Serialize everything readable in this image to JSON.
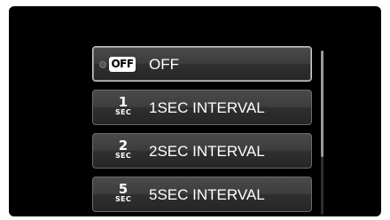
{
  "menu": {
    "items": [
      {
        "icon": "off-icon",
        "icon_text": "OFF",
        "label": "OFF",
        "selected": true
      },
      {
        "icon": "1sec-icon",
        "icon_num": "1",
        "icon_unit": "SEC",
        "label": "1SEC INTERVAL",
        "selected": false
      },
      {
        "icon": "2sec-icon",
        "icon_num": "2",
        "icon_unit": "SEC",
        "label": "2SEC INTERVAL",
        "selected": false
      },
      {
        "icon": "5sec-icon",
        "icon_num": "5",
        "icon_unit": "SEC",
        "label": "5SEC INTERVAL",
        "selected": false
      }
    ]
  },
  "colors": {
    "background": "#000000",
    "item_fill": "#3d3d3d",
    "item_border": "#6b6b6b",
    "selected_border": "#c9c9c9",
    "text": "#ffffff"
  }
}
